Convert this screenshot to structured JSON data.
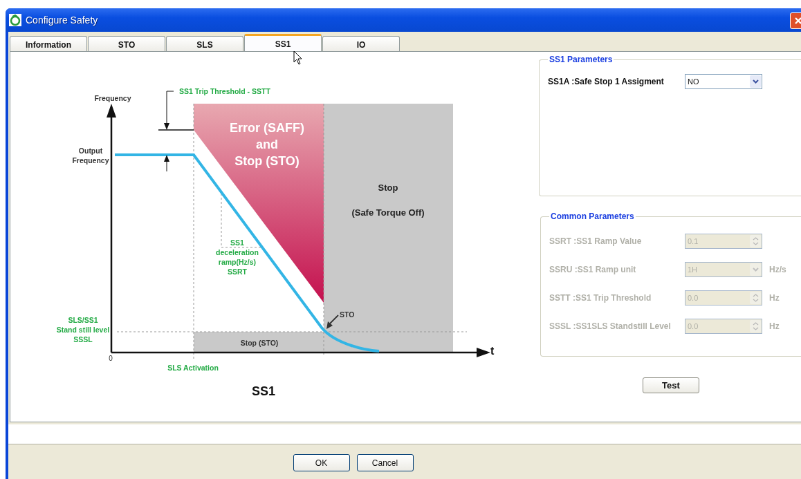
{
  "window": {
    "title": "Configure Safety"
  },
  "tabs": [
    {
      "label": "Information",
      "selected": false
    },
    {
      "label": "STO",
      "selected": false
    },
    {
      "label": "SLS",
      "selected": false
    },
    {
      "label": "SS1",
      "selected": true
    },
    {
      "label": "IO",
      "selected": false
    }
  ],
  "diagram": {
    "y_axis_label": "Frequency",
    "x_axis_label": "t",
    "origin_label": "0",
    "trip_threshold_label": "SS1 Trip Threshold - SSTT",
    "output_frequency_label": [
      "Output",
      "Frequency"
    ],
    "error_zone_label": [
      "Error (SAFF)",
      "and",
      "Stop (STO)"
    ],
    "stop_zone_label": [
      "Stop",
      "(Safe Torque Off)"
    ],
    "ramp_label": [
      "SS1",
      "deceleration",
      "ramp(Hz/s)",
      "SSRT"
    ],
    "sto_point_label": "STO",
    "standstill_label": [
      "SLS/SS1",
      "Stand still level",
      "SSSL"
    ],
    "stop_band_label": "Stop (STO)",
    "activation_label": "SLS Activation",
    "title": "SS1"
  },
  "ss1_parameters": {
    "title": "SS1 Parameters",
    "fields": [
      {
        "label": "SS1A :Safe Stop 1 Assigment",
        "value": "NO",
        "kind": "dropdown",
        "disabled": false
      }
    ]
  },
  "common_parameters": {
    "title": "Common Parameters",
    "fields": [
      {
        "label": "SSRT :SS1 Ramp Value",
        "value": "0.1",
        "kind": "spinner",
        "disabled": true
      },
      {
        "label": "SSRU :SS1 Ramp unit",
        "value": "1H",
        "kind": "dropdown",
        "unit": "Hz/s",
        "disabled": true
      },
      {
        "label": "SSTT :SS1 Trip Threshold",
        "value": "0.0",
        "kind": "spinner",
        "unit": "Hz",
        "disabled": true
      },
      {
        "label": "SSSL :SS1SLS Standstill Level",
        "value": "0.0",
        "kind": "spinner",
        "unit": "Hz",
        "disabled": true
      }
    ]
  },
  "test_button": "Test",
  "buttons": [
    "OK",
    "Cancel"
  ]
}
